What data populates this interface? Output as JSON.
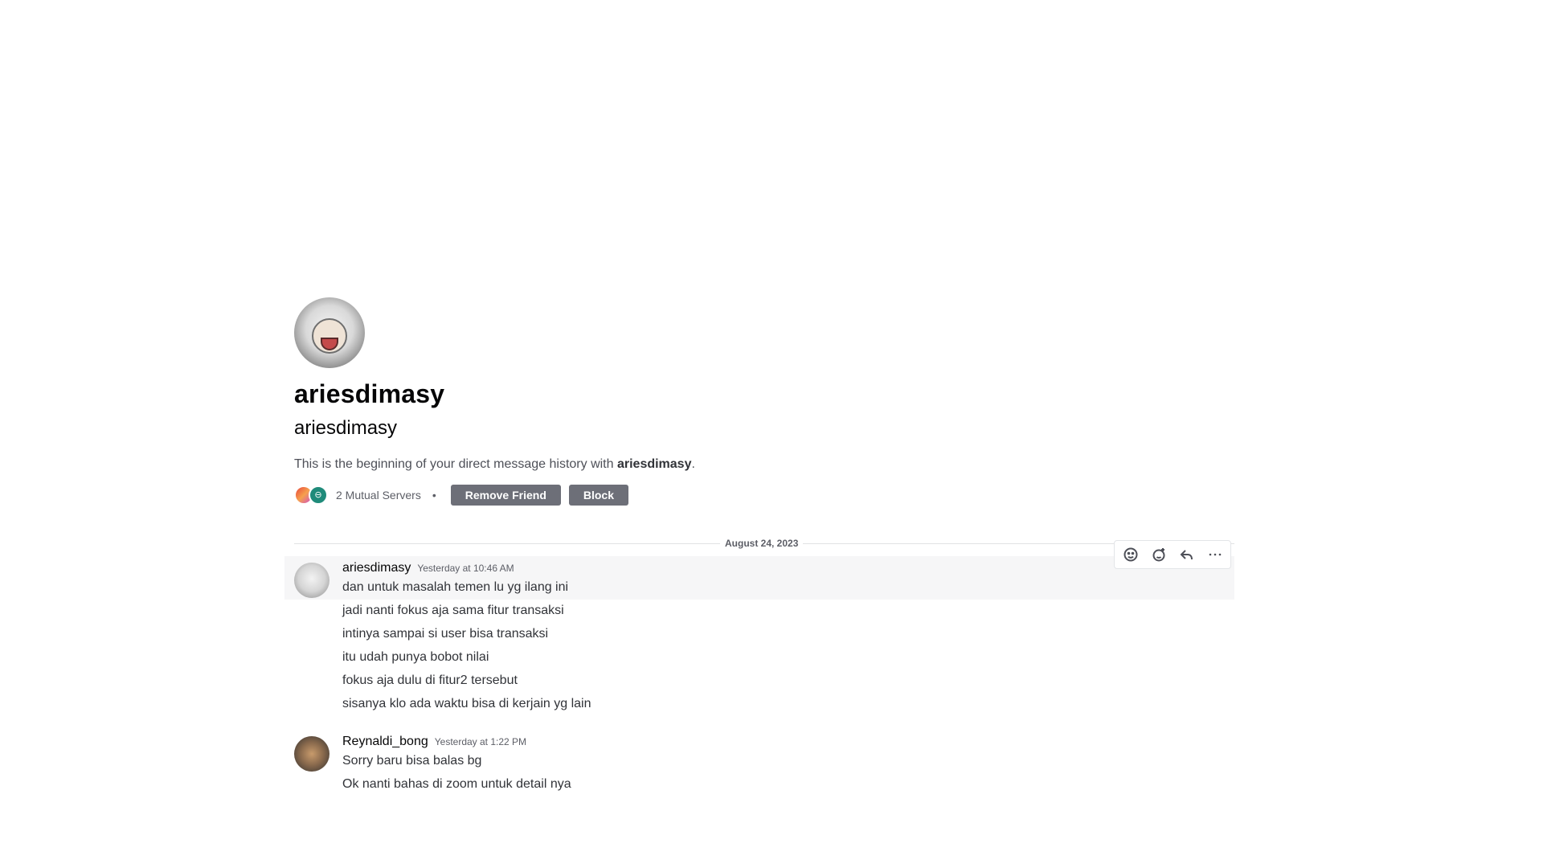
{
  "profile": {
    "display_name": "ariesdimasy",
    "username": "ariesdimasy",
    "intro_prefix": "This is the beginning of your direct message history with ",
    "intro_name": "ariesdimasy",
    "intro_suffix": "."
  },
  "mutual": {
    "label": "2 Mutual Servers",
    "separator": "•",
    "remove_friend_label": "Remove Friend",
    "block_label": "Block"
  },
  "divider": {
    "date": "August 24, 2023"
  },
  "messages": [
    {
      "author": "ariesdimasy",
      "time": "Yesterday at 10:46 AM",
      "lines": [
        "dan untuk masalah temen lu yg ilang ini",
        "jadi nanti fokus aja sama fitur transaksi",
        "intinya sampai si user bisa transaksi",
        "itu udah punya bobot nilai",
        "fokus aja dulu di fitur2 tersebut",
        "sisanya klo ada waktu bisa di kerjain yg lain"
      ]
    },
    {
      "author": "Reynaldi_bong",
      "time": "Yesterday at 1:22 PM",
      "lines": [
        "Sorry baru bisa balas bg",
        "Ok nanti bahas di zoom untuk detail nya"
      ]
    }
  ],
  "toolbar_icons": [
    "add-reaction-icon",
    "super-reaction-icon",
    "reply-icon",
    "more-icon"
  ]
}
